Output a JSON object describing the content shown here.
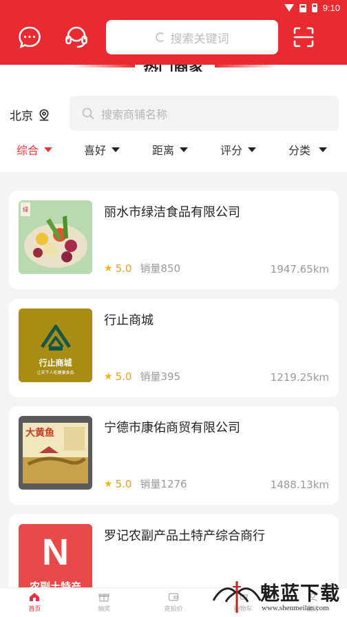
{
  "status_bar": {
    "time": "9:10"
  },
  "header": {
    "search_placeholder": "搜索关键词",
    "icons": [
      "chat-icon",
      "headset-icon",
      "scan-icon"
    ]
  },
  "section": {
    "title": "热门商家"
  },
  "filters": {
    "city": "北京",
    "shop_search_placeholder": "搜索商铺名称",
    "sorts": [
      "综合",
      "喜好",
      "距离",
      "评分",
      "分类"
    ],
    "active_sort": "综合"
  },
  "colors": {
    "brand": "#ea2a31",
    "accent_text": "#e5333b",
    "rating": "#e7a21a"
  },
  "shops": [
    {
      "name": "丽水市绿洁食品有限公司",
      "rating": "5.0",
      "sales": "销量850",
      "distance": "1947.65km"
    },
    {
      "name": "行止商城",
      "rating": "5.0",
      "sales": "销量395",
      "distance": "1219.25km",
      "logo_text": "行止商城",
      "logo_sub": "让天下人吃健康食品"
    },
    {
      "name": "宁德市康佑商贸有限公司",
      "rating": "5.0",
      "sales": "销量1276",
      "distance": "1488.13km",
      "logo_text": "大黄鱼"
    },
    {
      "name": "罗记农副产品土特产综合商行",
      "logo_letter": "N",
      "logo_text": "农副土特产"
    }
  ],
  "tabbar": [
    {
      "label": "首页",
      "active": true
    },
    {
      "label": "抽奖"
    },
    {
      "label": "竞拍价"
    },
    {
      "label": "购物车"
    },
    {
      "label": "我的"
    }
  ],
  "watermark": {
    "text": "魅蓝下载",
    "url": "www.shenmeilan.com"
  }
}
